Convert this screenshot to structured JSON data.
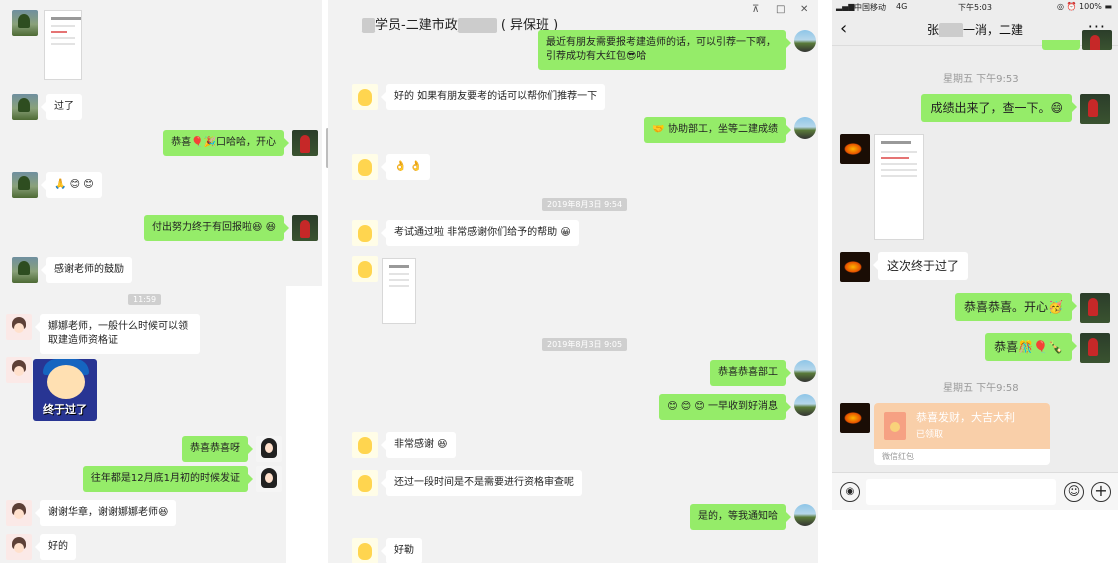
{
  "panel1": {
    "msg_guole": "过了",
    "msg_gongxi": "恭喜🎈🎉口哈哈，开心",
    "msg_emoji_row": "🙏 😊 😊",
    "msg_fuchu": "付出努力终于有回报啦😆 😆",
    "msg_ganxie": "感谢老师的鼓励",
    "time_1": "11:59",
    "msg_nana_q": "娜娜老师，一般什么时候可以领取建造师资格证",
    "sticker_caption": "终于过了",
    "msg_gongxi_ya": "恭喜恭喜呀",
    "msg_wangnian": "往年都是12月底1月初的时候发证",
    "msg_xiexie": "谢谢华章，谢谢娜娜老师😆",
    "msg_hao": "好的"
  },
  "panel2": {
    "title_prefix": "学员-二建市政",
    "title_suffix": "( 异保班 )",
    "win_pin": "⊼",
    "win_max": "□",
    "win_close": "✕",
    "msg_top": "最近有朋友需要报考建造师的话，可以引荐一下啊，引荐成功有大红包😎哈",
    "msg_haode": "好的  如果有朋友要考的话可以帮你们推荐一下",
    "msg_hands": "👌 👌",
    "msg_xiezhu": "🤝 协助部工，坐等二建成绩",
    "time_1": "2019年8月3日 9:54",
    "msg_kaoshi": "考试通过啦    非常感谢你们给予的帮助 😀",
    "time_2": "2019年8月3日 9:05",
    "msg_gongxi_bugong": "恭喜恭喜部工",
    "msg_yizao": "😊  😊  😊 一早收到好消息",
    "msg_feichang": "非常感谢 😆",
    "msg_zige": "还过一段时间是不是需要进行资格审查呢",
    "msg_shide": "是的，等我通知哈",
    "msg_haode2": "好勒"
  },
  "panel3": {
    "carrier": "中国移动",
    "network": "4G",
    "clock": "下午5:03",
    "status_icons": "◎ ⏰ 100% ▬",
    "title_prefix": "张",
    "title_suffix": "一消，二建",
    "time_1": "星期五 下午9:53",
    "msg_chengji": "成绩出来了，查一下。😄",
    "msg_zhongyu": "这次终于过了",
    "msg_gongxi": "恭喜恭喜。开心🥳",
    "msg_gongxi2": "恭喜🎊🎈🍾",
    "time_2": "星期五 下午9:58",
    "redpacket_msg": "恭喜发财，大吉大利",
    "redpacket_sub": "已领取",
    "redpacket_label": "微信红包"
  }
}
